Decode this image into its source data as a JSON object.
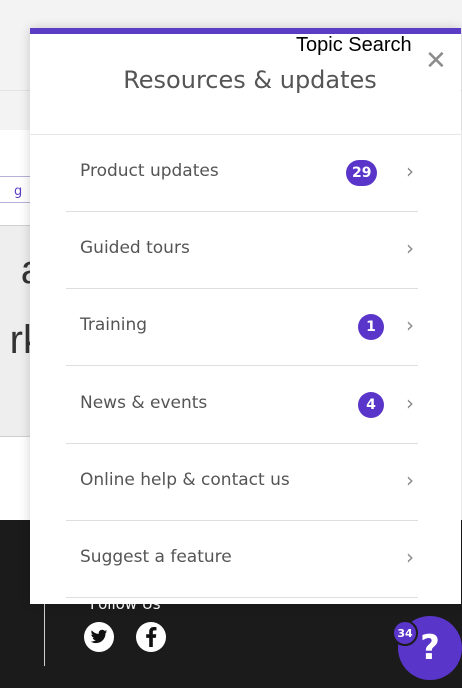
{
  "background": {
    "link_fragment": "g",
    "overlay_lines": [
      "a",
      "rk"
    ],
    "follow_label": "Follow Us",
    "social": [
      "twitter-icon",
      "facebook-icon"
    ]
  },
  "topic_search": "Topic Search",
  "panel": {
    "title": "Resources & updates",
    "items": [
      {
        "label": "Product updates",
        "badge": "29"
      },
      {
        "label": "Guided tours",
        "badge": ""
      },
      {
        "label": "Training",
        "badge": "1"
      },
      {
        "label": "News & events",
        "badge": "4"
      },
      {
        "label": "Online help & contact us",
        "badge": ""
      },
      {
        "label": "Suggest a feature",
        "badge": ""
      }
    ]
  },
  "help": {
    "badge": "34",
    "icon_label": "?"
  },
  "colors": {
    "accent": "#5a35c9",
    "text": "#555555"
  }
}
